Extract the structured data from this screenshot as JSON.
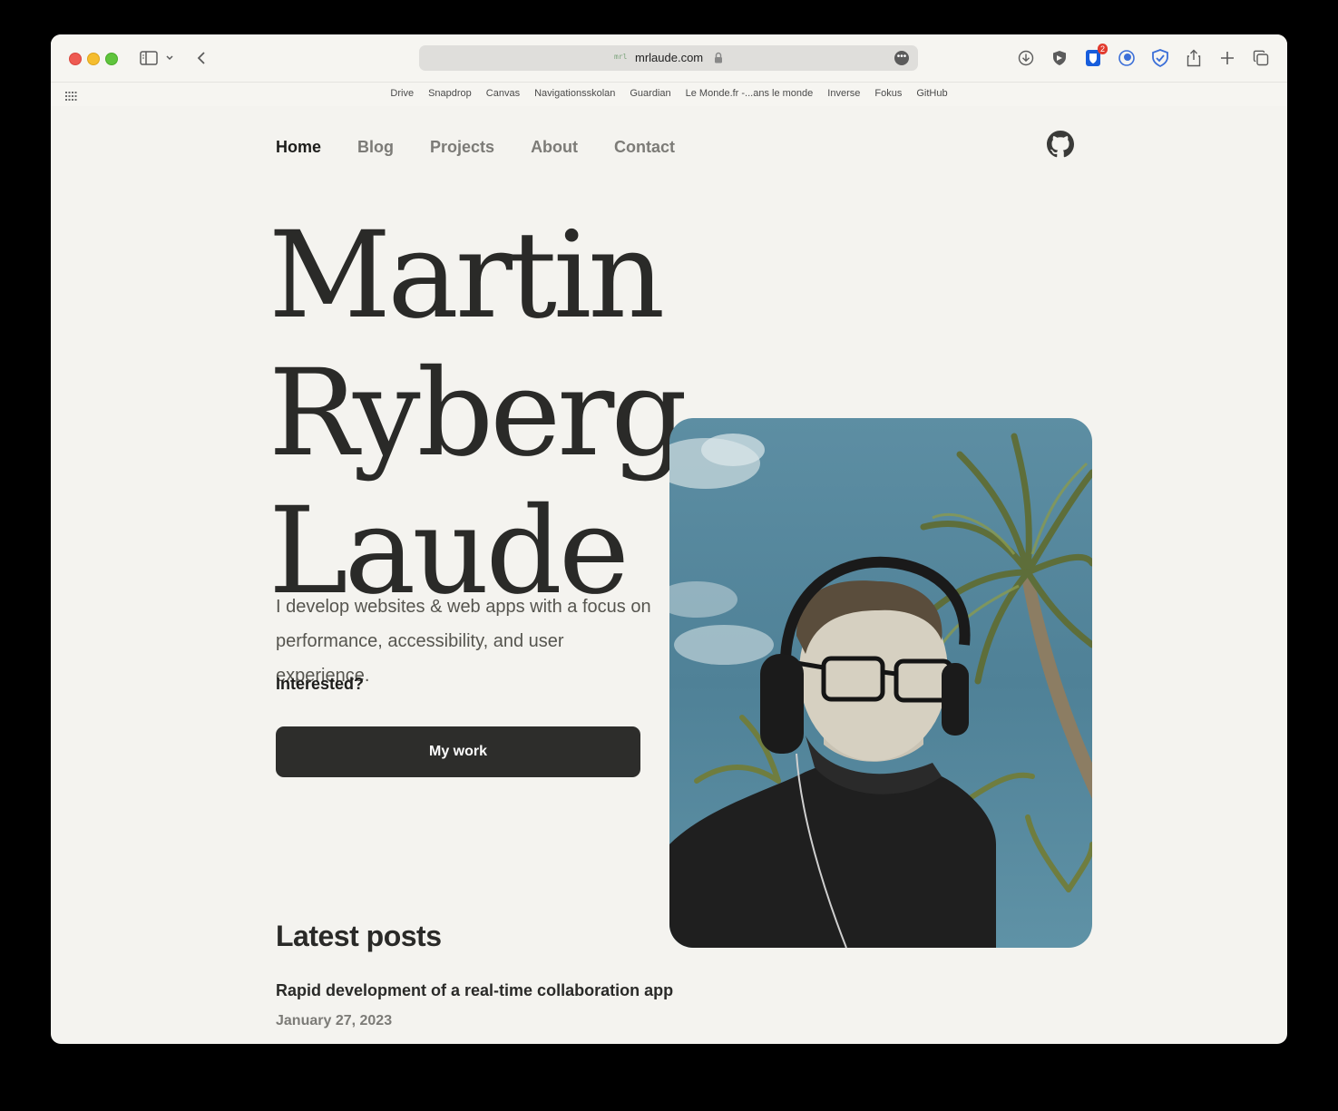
{
  "browser": {
    "url": "mrlaude.com",
    "favicon_text": "mrl",
    "notification_count": "2",
    "favorites": [
      "Drive",
      "Snapdrop",
      "Canvas",
      "Navigationsskolan",
      "Guardian",
      "Le Monde.fr -...ans le monde",
      "Inverse",
      "Fokus",
      "GitHub"
    ]
  },
  "nav": {
    "items": [
      {
        "label": "Home",
        "active": true
      },
      {
        "label": "Blog"
      },
      {
        "label": "Projects"
      },
      {
        "label": "About"
      },
      {
        "label": "Contact"
      }
    ]
  },
  "hero": {
    "name_line1": "Martin Ryberg",
    "name_line2": "Laude",
    "intro": "I develop websites & web apps with a focus on performance, accessibility, and user experience.",
    "cta_prompt": "Interested?",
    "cta_button": "My work"
  },
  "latest": {
    "heading": "Latest posts",
    "posts": [
      {
        "title": "Rapid development of a real-time collaboration app",
        "date": "January 27, 2023"
      }
    ]
  },
  "colors": {
    "page_bg": "#f4f3ef",
    "text_dark": "#2a2a28",
    "text_muted": "#7c7b77",
    "button_bg": "#2d2d2b"
  }
}
